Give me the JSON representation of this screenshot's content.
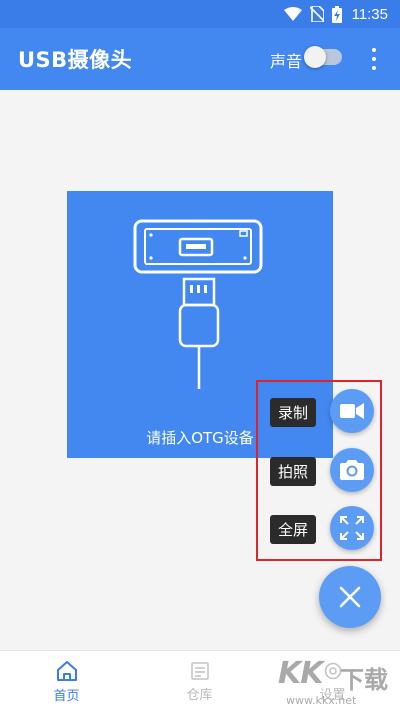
{
  "status_bar": {
    "time": "11:35"
  },
  "app_bar": {
    "title": "USB摄像头",
    "sound_label": "声音",
    "sound_toggle_on": false
  },
  "otg_panel": {
    "text": "请插入OTG设备"
  },
  "fab_menu": {
    "record_label": "录制",
    "photo_label": "拍照",
    "fullscreen_label": "全屏"
  },
  "bottom_nav": {
    "items": [
      {
        "label": "首页",
        "icon": "home-icon",
        "active": true
      },
      {
        "label": "仓库",
        "icon": "warehouse-icon",
        "active": false
      },
      {
        "label": "设置",
        "icon": "settings-icon",
        "active": false
      }
    ]
  },
  "watermark": {
    "brand": "KK",
    "suffix": "下载",
    "url": "www.kkx.net"
  },
  "colors": {
    "primary": "#4288f0",
    "accent": "#5c9cf5",
    "highlight": "#e0242c"
  }
}
